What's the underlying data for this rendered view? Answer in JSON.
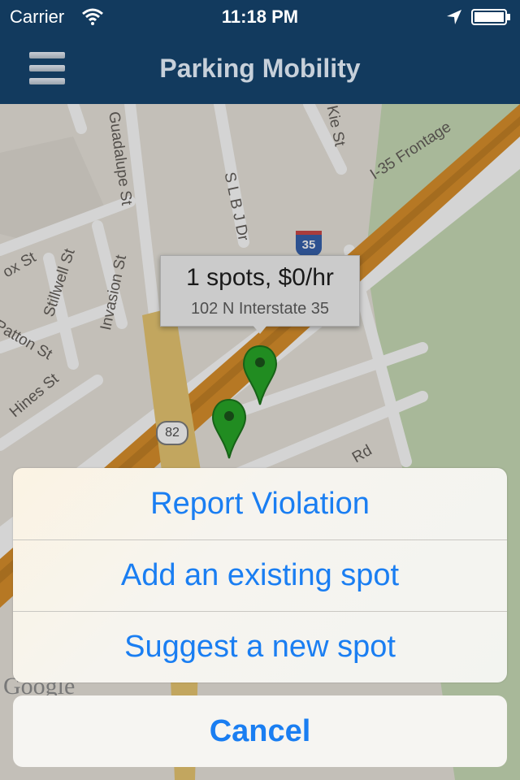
{
  "status_bar": {
    "carrier": "Carrier",
    "time": "11:18 PM"
  },
  "nav": {
    "title": "Parking Mobility",
    "menu_icon": "hamburger-icon"
  },
  "map": {
    "street_labels": [
      "Guadalupe St",
      "S L B J Dr",
      "Kie St",
      "I-35 Frontage",
      "Stillwell St",
      "Invasion St",
      "Patton St",
      "Hines St",
      "Rd",
      "ox St"
    ],
    "interstate_shield": "35",
    "route_shield": "82",
    "google_logo": "Google",
    "callout": {
      "title": "1 spots, $0/hr",
      "address": "102 N Interstate 35"
    },
    "pin_color": "#1aa31a"
  },
  "action_sheet": {
    "options": [
      "Report Violation",
      "Add an existing spot",
      "Suggest a new spot"
    ],
    "cancel": "Cancel"
  },
  "colors": {
    "nav_bg": "#123a5e",
    "accent": "#1a7ef2",
    "highway": "#d98a1e"
  }
}
